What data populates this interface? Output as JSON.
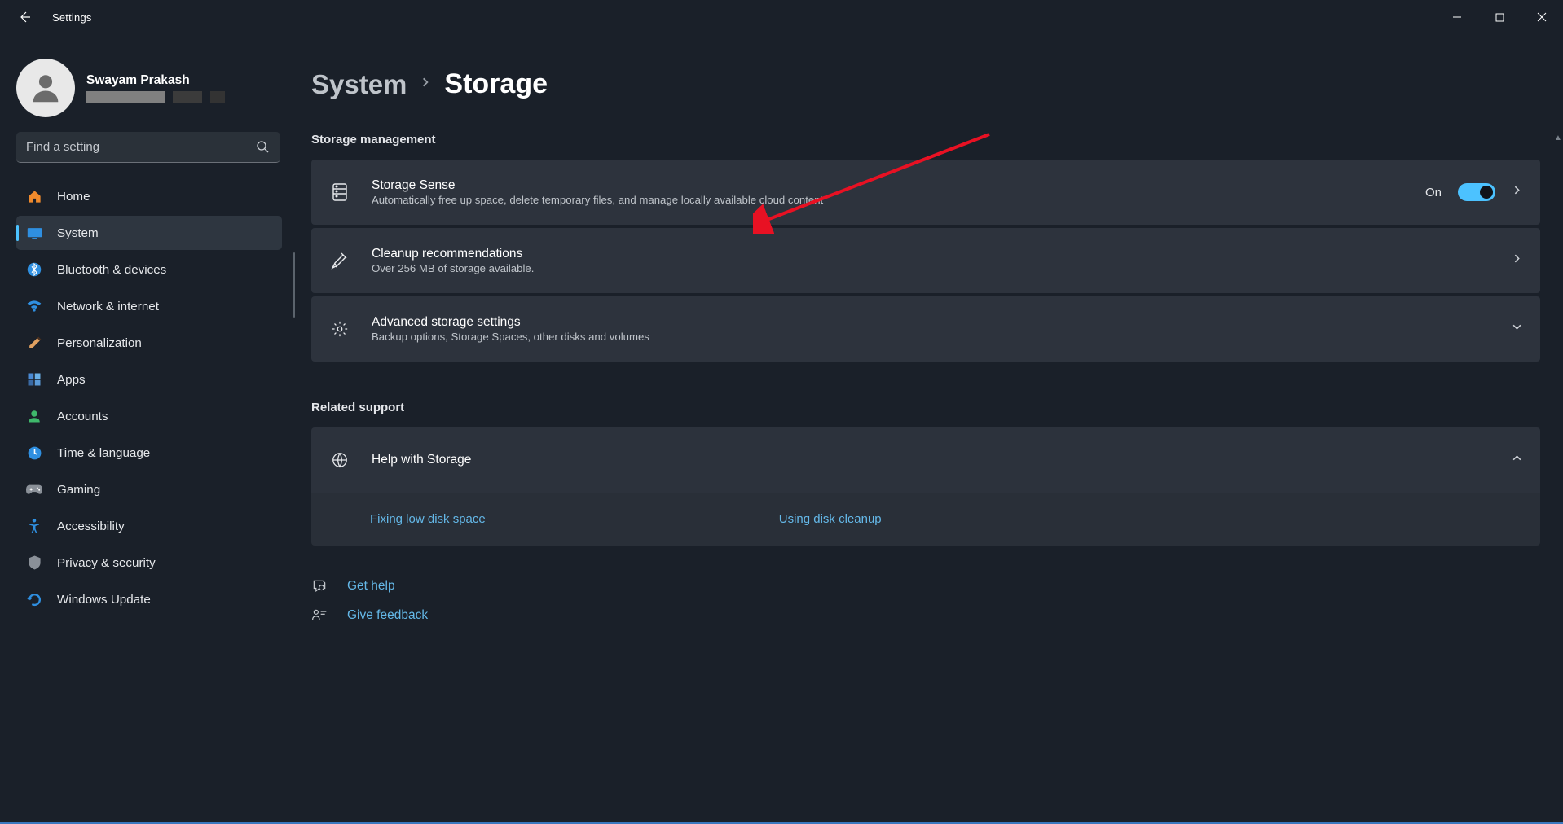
{
  "window": {
    "title": "Settings"
  },
  "profile": {
    "name": "Swayam Prakash"
  },
  "search": {
    "placeholder": "Find a setting"
  },
  "sidebar": {
    "items": [
      {
        "label": "Home",
        "icon": "home"
      },
      {
        "label": "System",
        "icon": "system",
        "active": true
      },
      {
        "label": "Bluetooth & devices",
        "icon": "bluetooth"
      },
      {
        "label": "Network & internet",
        "icon": "wifi"
      },
      {
        "label": "Personalization",
        "icon": "brush"
      },
      {
        "label": "Apps",
        "icon": "apps"
      },
      {
        "label": "Accounts",
        "icon": "accounts"
      },
      {
        "label": "Time & language",
        "icon": "time"
      },
      {
        "label": "Gaming",
        "icon": "gaming"
      },
      {
        "label": "Accessibility",
        "icon": "accessibility"
      },
      {
        "label": "Privacy & security",
        "icon": "privacy"
      },
      {
        "label": "Windows Update",
        "icon": "update"
      }
    ]
  },
  "breadcrumb": {
    "parent": "System",
    "current": "Storage"
  },
  "sections": {
    "management": {
      "heading": "Storage management"
    },
    "related": {
      "heading": "Related support"
    }
  },
  "cards": {
    "storageSense": {
      "title": "Storage Sense",
      "sub": "Automatically free up space, delete temporary files, and manage locally available cloud content",
      "toggleLabel": "On"
    },
    "cleanup": {
      "title": "Cleanup recommendations",
      "sub": "Over 256 MB of storage available."
    },
    "advanced": {
      "title": "Advanced storage settings",
      "sub": "Backup options, Storage Spaces, other disks and volumes"
    },
    "help": {
      "title": "Help with Storage",
      "links": {
        "fix": "Fixing low disk space",
        "cleanup": "Using disk cleanup"
      }
    }
  },
  "footer": {
    "getHelp": "Get help",
    "feedback": "Give feedback"
  }
}
